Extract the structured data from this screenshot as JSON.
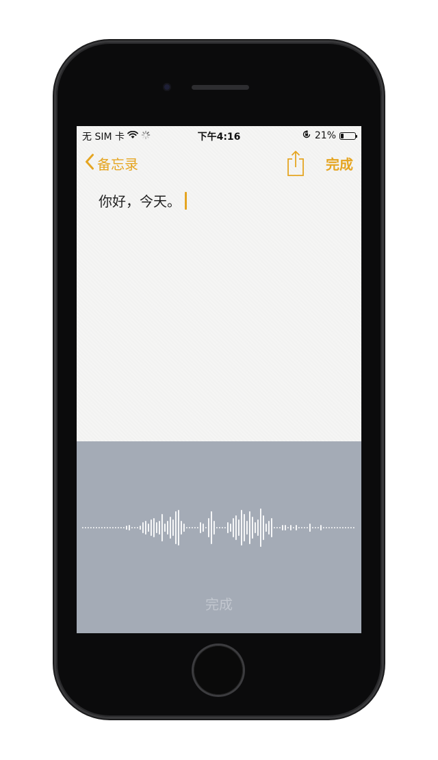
{
  "status_bar": {
    "carrier": "无 SIM 卡",
    "time": "下午4:16",
    "battery_percent_label": "21%",
    "battery_level": 0.21,
    "icons": [
      "wifi-icon",
      "activity-spinner-icon",
      "orientation-lock-icon",
      "battery-icon"
    ]
  },
  "nav_bar": {
    "back_label": "备忘录",
    "share_icon": "share-icon",
    "done_label": "完成"
  },
  "note": {
    "text": "你好，今天。"
  },
  "dictation": {
    "done_label": "完成",
    "waveform_icon": "audio-waveform-icon"
  },
  "colors": {
    "accent": "#e5a521",
    "dictation_bg": "#a4abb6",
    "waveform": "#ffffff",
    "done_disabled": "#c2c7cf"
  }
}
